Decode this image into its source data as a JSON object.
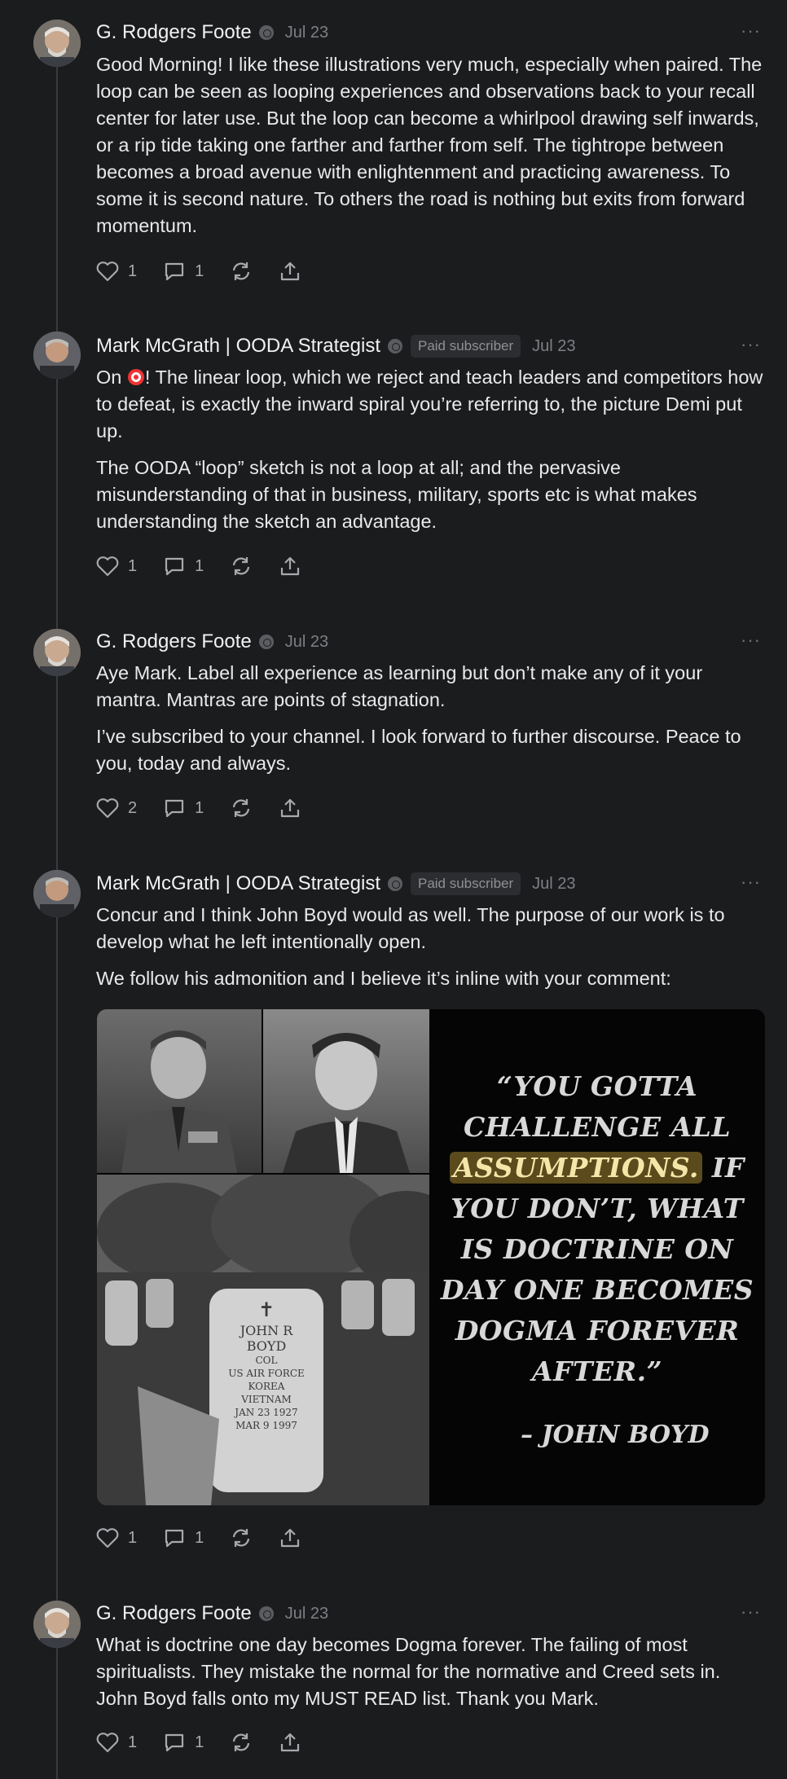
{
  "comments": [
    {
      "author": "G. Rodgers Foote",
      "date": "Jul 23",
      "paragraphs": [
        "Good Morning! I like these illustrations very much, especially when paired. The loop can be seen as looping experiences and observations back to your recall center for later use. But the loop can become a whirlpool drawing self inwards, or a rip tide taking one farther and farther from self. The tightrope between becomes a broad avenue with enlightenment and practicing awareness. To some it is second nature. To others the road is nothing but exits from forward momentum."
      ],
      "likes": "1",
      "replies": "1"
    },
    {
      "author": "Mark McGrath | OODA Strategist",
      "badge": "Paid subscriber",
      "date": "Jul 23",
      "p1_before": "On ",
      "p1_after": "! The linear loop, which we reject and teach leaders and competitors how to defeat, is exactly the inward spiral you’re referring to, the picture Demi put up.",
      "paragraphs": [
        "The OODA “loop” sketch is not a loop at all; and the pervasive misunderstanding of that in business, military, sports etc is what makes understanding the sketch an advantage."
      ],
      "likes": "1",
      "replies": "1"
    },
    {
      "author": "G. Rodgers Foote",
      "date": "Jul 23",
      "paragraphs": [
        "Aye Mark. Label all experience as learning but don’t make any of it your mantra. Mantras are points of stagnation.",
        "I’ve subscribed to your channel. I look forward to further discourse. Peace to you, today and always."
      ],
      "likes": "2",
      "replies": "1"
    },
    {
      "author": "Mark McGrath | OODA Strategist",
      "badge": "Paid subscriber",
      "date": "Jul 23",
      "paragraphs": [
        "Concur and I think John Boyd would as well. The purpose of our work is to develop what he left intentionally open.",
        "We follow his admonition and I believe it’s inline with your comment:"
      ],
      "image": {
        "quote_line1": "“YOU GOTTA",
        "quote_line2": "CHALLENGE ALL",
        "quote_highlight": "ASSUMPTIONS.",
        "quote_line3_rest": " IF",
        "quote_line4": "YOU DON’T, WHAT",
        "quote_line5": "IS DOCTRINE ON",
        "quote_line6": "DAY ONE BECOMES",
        "quote_line7": "DOGMA FOREVER",
        "quote_line8": "AFTER.”",
        "attribution": "– JOHN BOYD",
        "headstone": [
          "JOHN R",
          "BOYD",
          "COL",
          "US AIR FORCE",
          "KOREA",
          "VIETNAM",
          "JAN 23 1927",
          "MAR 9 1997"
        ]
      },
      "likes": "1",
      "replies": "1"
    },
    {
      "author": "G. Rodgers Foote",
      "date": "Jul 23",
      "paragraphs": [
        "What is doctrine one day becomes Dogma forever. The failing of most spiritualists. They mistake the normal for the normative and Creed sets in. John Boyd falls onto my MUST READ list. Thank you Mark."
      ],
      "likes": "1",
      "replies": "1"
    }
  ],
  "more_label": "···",
  "icons": [
    "heart-icon",
    "comment-icon",
    "restack-icon",
    "share-icon",
    "verified-badge-icon",
    "target-emoji"
  ],
  "colors": {
    "background": "#1b1c1e",
    "text": "#e9e9ea",
    "muted": "#7e7f84",
    "highlight": "#5a4a1c"
  }
}
